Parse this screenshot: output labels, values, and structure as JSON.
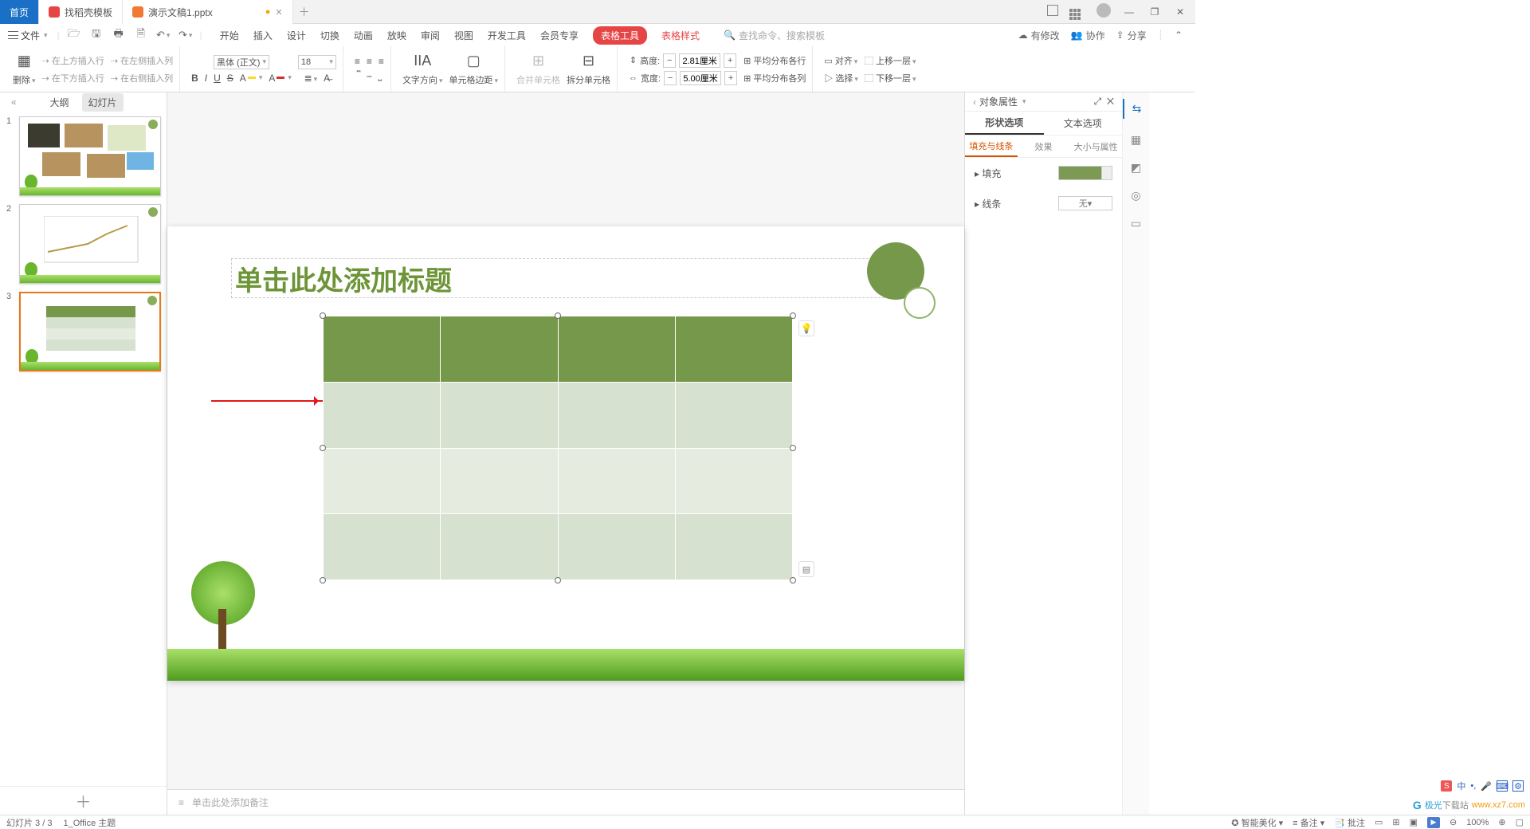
{
  "tabs": {
    "home": "首页",
    "template": "找稻壳模板",
    "doc": "演示文稿1.pptx"
  },
  "file_menu": "文件",
  "ribbonTabs": [
    "开始",
    "插入",
    "设计",
    "切换",
    "动画",
    "放映",
    "审阅",
    "视图",
    "开发工具",
    "会员专享"
  ],
  "tableTool": "表格工具",
  "tableStyle": "表格样式",
  "search_placeholder": "查找命令、搜索模板",
  "cloud": {
    "a": "有修改",
    "b": "协作",
    "c": "分享"
  },
  "ins": {
    "del": "删除",
    "up": "在上方插入行",
    "left": "在左侧插入列",
    "down": "在下方插入行",
    "right": "在右侧插入列"
  },
  "font": {
    "name": "黑体 (正文)",
    "size": "18"
  },
  "textdir": "文字方向",
  "cellmargin": "单元格边距",
  "merge": "合并单元格",
  "split": "拆分单元格",
  "dim": {
    "hlabel": "高度:",
    "wlabel": "宽度:",
    "h": "2.81厘米",
    "w": "5.00厘米",
    "rows": "平均分布各行",
    "cols": "平均分布各列"
  },
  "align": "对齐",
  "fwd": "上移一层",
  "back": "下移一层",
  "sel": "选择",
  "thumbTabs": {
    "outline": "大纲",
    "slides": "幻灯片"
  },
  "slideTitle": "单击此处添加标题",
  "notes": "单击此处添加备注",
  "rightPanel": {
    "title": "对象属性",
    "t1": "形状选项",
    "t2": "文本选项",
    "s1": "填充与线条",
    "s2": "效果",
    "s3": "大小与属性",
    "fill": "填充",
    "line": "线条",
    "none": "无"
  },
  "status": {
    "slide": "幻灯片 3 / 3",
    "theme": "1_Office 主题",
    "ai": "智能美化",
    "bkp": "备注",
    "cmt": "批注",
    "zoom": "100%"
  },
  "logo": {
    "a": "极光",
    "b": "下载站",
    "url": "www.xz7.com"
  }
}
